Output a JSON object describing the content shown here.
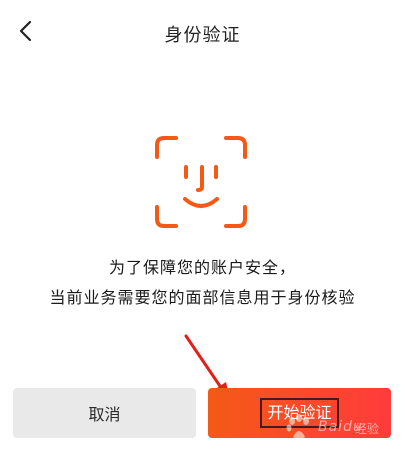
{
  "header": {
    "title": "身份验证",
    "back_icon": "chevron-left-icon"
  },
  "face_icon": "face-scan-icon",
  "message": {
    "line1": "为了保障您的账户安全，",
    "line2": "当前业务需要您的面部信息用于身份核验"
  },
  "buttons": {
    "cancel_label": "取消",
    "start_label": "开始验证"
  },
  "watermark": {
    "brand": "Baidu",
    "suffix": "经验"
  },
  "colors": {
    "accent": "#f45a16",
    "button_gradient_end": "#ff3b3b",
    "cancel_bg": "#e9e9e9",
    "annotation_arrow": "#e0201a"
  }
}
